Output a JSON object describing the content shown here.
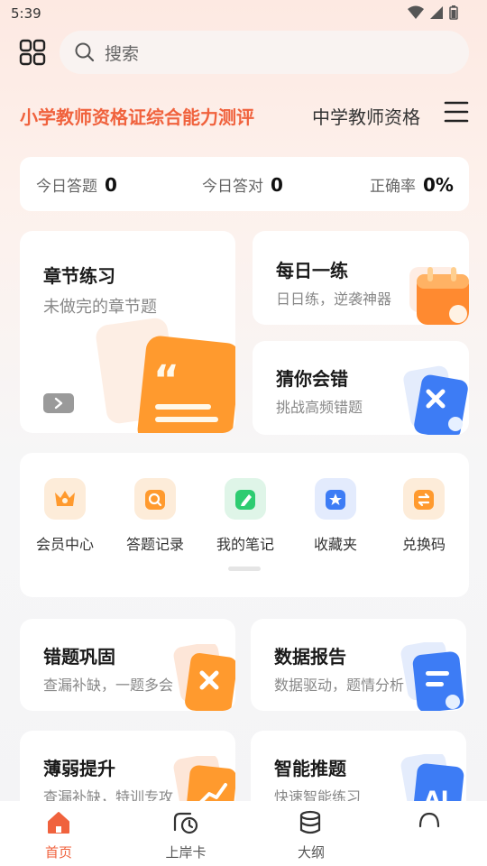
{
  "status": {
    "time": "5:39"
  },
  "search": {
    "placeholder": "搜索"
  },
  "subjects": {
    "active": "小学教师资格证综合能力测评",
    "next": "中学教师资格"
  },
  "stats": [
    {
      "label": "今日答题",
      "value": "0"
    },
    {
      "label": "今日答对",
      "value": "0"
    },
    {
      "label": "正确率",
      "value": "0%"
    }
  ],
  "chapter": {
    "title": "章节练习",
    "sub": "未做完的章节题"
  },
  "daily": {
    "title": "每日一练",
    "sub": "日日练，逆袭神器"
  },
  "guess": {
    "title": "猜你会错",
    "sub": "挑战高频错题"
  },
  "quick": [
    {
      "label": "会员中心",
      "icon": "crown-icon"
    },
    {
      "label": "答题记录",
      "icon": "search-record-icon"
    },
    {
      "label": "我的笔记",
      "icon": "note-edit-icon"
    },
    {
      "label": "收藏夹",
      "icon": "star-icon"
    },
    {
      "label": "兑换码",
      "icon": "exchange-icon"
    }
  ],
  "features": [
    {
      "title": "错题巩固",
      "sub": "查漏补缺，一题多会"
    },
    {
      "title": "数据报告",
      "sub": "数据驱动，题情分析"
    },
    {
      "title": "薄弱提升",
      "sub": "查漏补缺，特训专攻"
    },
    {
      "title": "智能推题",
      "sub": "快速智能练习"
    }
  ],
  "tabs": [
    {
      "label": "首页",
      "icon": "home-icon"
    },
    {
      "label": "上岸卡",
      "icon": "landing-card-icon"
    },
    {
      "label": "大纲",
      "icon": "outline-icon"
    },
    {
      "label": "",
      "icon": "profile-icon"
    }
  ],
  "colors": {
    "accent": "#f0623d",
    "orange": "#ff9a2e",
    "blue": "#3d7cf5",
    "green": "#2ecc71"
  }
}
